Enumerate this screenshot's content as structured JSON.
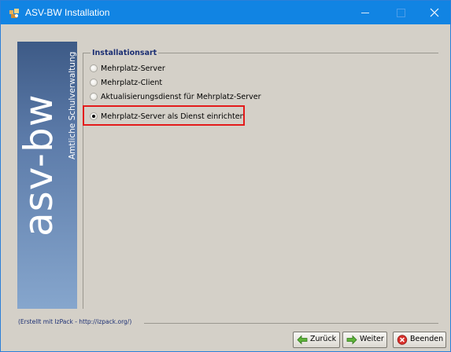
{
  "window": {
    "title": "ASV-BW Installation",
    "accent": "#1184e3"
  },
  "side_panel": {
    "brand": "asv-bw",
    "tagline": "Amtliche Schulverwaltung"
  },
  "installation_type": {
    "legend": "Installationsart",
    "options": [
      {
        "label": "Mehrplatz-Server",
        "selected": false
      },
      {
        "label": "Mehrplatz-Client",
        "selected": false
      },
      {
        "label": "Aktualisierungsdienst für Mehrplatz-Server",
        "selected": false
      },
      {
        "label": "Mehrplatz-Server als Dienst einrichten",
        "selected": true
      }
    ],
    "highlight_color": "#e31b1b"
  },
  "footer": {
    "credit": "(Erstellt mit IzPack - http://izpack.org/)"
  },
  "buttons": {
    "back": "Zurück",
    "next": "Weiter",
    "quit": "Beenden"
  }
}
